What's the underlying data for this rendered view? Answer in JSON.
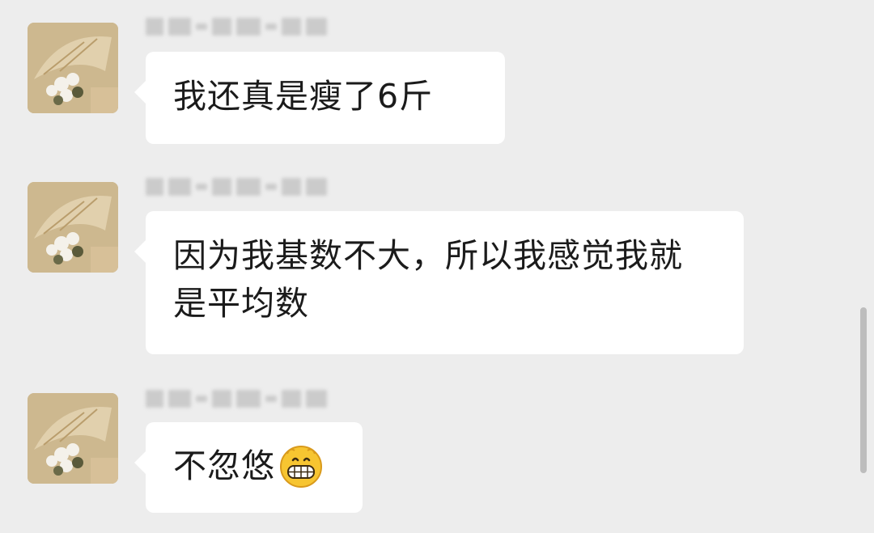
{
  "messages": [
    {
      "text": "我还真是瘦了6斤",
      "avatar_icon": "umbrella-avatar-icon"
    },
    {
      "text": "因为我基数不大，所以我感觉我就是平均数",
      "avatar_icon": "umbrella-avatar-icon"
    },
    {
      "text": "不忽悠",
      "emoji": "grinning-face-icon",
      "avatar_icon": "umbrella-avatar-icon"
    }
  ],
  "colors": {
    "background": "#ededed",
    "bubble": "#ffffff",
    "text": "#1b1b1b",
    "scrollbar": "#bdbdbd"
  }
}
